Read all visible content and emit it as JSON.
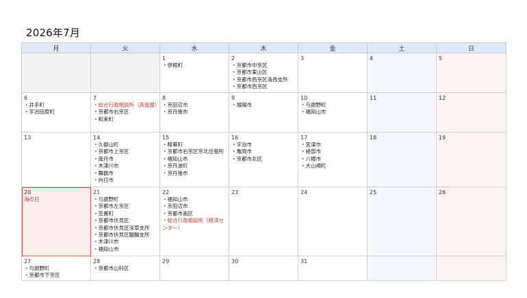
{
  "header": {
    "title": "2026年7月"
  },
  "weekdays": [
    "月",
    "火",
    "水",
    "木",
    "金",
    "土",
    "日"
  ],
  "weeks": [
    [
      {
        "day": "",
        "type": "empty",
        "holiday": "",
        "events": []
      },
      {
        "day": "",
        "type": "empty",
        "holiday": "",
        "events": []
      },
      {
        "day": "1",
        "type": "wk",
        "holiday": "",
        "events": [
          {
            "text": "・伊根町"
          }
        ]
      },
      {
        "day": "2",
        "type": "wk",
        "holiday": "",
        "events": [
          {
            "text": "・京都市中京区"
          },
          {
            "text": "・京都市東山区"
          },
          {
            "text": "・京都市西京区洛西支所"
          },
          {
            "text": "・京都市西京区"
          }
        ]
      },
      {
        "day": "3",
        "type": "wk",
        "holiday": "",
        "events": []
      },
      {
        "day": "4",
        "type": "sat",
        "holiday": "",
        "events": []
      },
      {
        "day": "5",
        "type": "sun",
        "holiday": "",
        "events": []
      }
    ],
    [
      {
        "day": "6",
        "type": "wk",
        "holiday": "",
        "events": [
          {
            "text": "・井手町"
          },
          {
            "text": "・宇治田原町"
          }
        ]
      },
      {
        "day": "7",
        "type": "wk",
        "holiday": "",
        "events": [
          {
            "text": "・総合行政相談所（高島屋）",
            "red": true,
            "wrap": true
          },
          {
            "text": "・京都市右京区"
          },
          {
            "text": "・和束町"
          }
        ]
      },
      {
        "day": "8",
        "type": "wk",
        "holiday": "",
        "events": [
          {
            "text": "・京田辺市"
          },
          {
            "text": "・京丹後市"
          }
        ]
      },
      {
        "day": "9",
        "type": "wk",
        "holiday": "",
        "events": [
          {
            "text": "・城陽市"
          }
        ]
      },
      {
        "day": "10",
        "type": "wk",
        "holiday": "",
        "events": [
          {
            "text": "・与謝野町"
          },
          {
            "text": "・福知山市"
          }
        ]
      },
      {
        "day": "11",
        "type": "sat",
        "holiday": "",
        "events": []
      },
      {
        "day": "12",
        "type": "sun",
        "holiday": "",
        "events": []
      }
    ],
    [
      {
        "day": "13",
        "type": "wk",
        "holiday": "",
        "events": []
      },
      {
        "day": "14",
        "type": "wk",
        "holiday": "",
        "events": [
          {
            "text": "・久御山町"
          },
          {
            "text": "・京都市上京区"
          },
          {
            "text": "・南丹市"
          },
          {
            "text": "・木津川市"
          },
          {
            "text": "・舞鶴市"
          },
          {
            "text": "・向日市"
          }
        ]
      },
      {
        "day": "15",
        "type": "wk",
        "holiday": "",
        "events": [
          {
            "text": "・精華町"
          },
          {
            "text": "・京都市右京区京北出張所",
            "wrap": true
          },
          {
            "text": "・福知山市"
          },
          {
            "text": "・京丹波町"
          },
          {
            "text": "・京丹後市"
          }
        ]
      },
      {
        "day": "16",
        "type": "wk",
        "holiday": "",
        "events": [
          {
            "text": "・宇治市"
          },
          {
            "text": "・亀岡市"
          },
          {
            "text": "・京都市北区"
          }
        ]
      },
      {
        "day": "17",
        "type": "wk",
        "holiday": "",
        "events": [
          {
            "text": "・宮津市"
          },
          {
            "text": "・綾部市"
          },
          {
            "text": "・八幡市"
          },
          {
            "text": "・大山崎町"
          }
        ]
      },
      {
        "day": "18",
        "type": "sat",
        "holiday": "",
        "events": []
      },
      {
        "day": "19",
        "type": "sun",
        "holiday": "",
        "events": []
      }
    ],
    [
      {
        "day": "20",
        "type": "hol",
        "holiday": "海の日",
        "events": []
      },
      {
        "day": "21",
        "type": "wk",
        "holiday": "",
        "events": [
          {
            "text": "・与謝野町"
          },
          {
            "text": "・京都市左京区"
          },
          {
            "text": "・笠置町"
          },
          {
            "text": "・京都市伏見区"
          },
          {
            "text": "・京都市伏見区深草支所"
          },
          {
            "text": "・京都市伏見区醍醐支所"
          },
          {
            "text": "・木津川市"
          },
          {
            "text": "・福知山市"
          }
        ]
      },
      {
        "day": "22",
        "type": "wk",
        "holiday": "",
        "events": [
          {
            "text": "・福知山市"
          },
          {
            "text": "・京田辺市"
          },
          {
            "text": "・京都市南区"
          },
          {
            "text": "・総合行政相談所（経済センター）",
            "red": true,
            "wrap": true
          }
        ]
      },
      {
        "day": "23",
        "type": "wk",
        "holiday": "",
        "events": []
      },
      {
        "day": "24",
        "type": "wk",
        "holiday": "",
        "events": []
      },
      {
        "day": "25",
        "type": "sat",
        "holiday": "",
        "events": []
      },
      {
        "day": "26",
        "type": "sun",
        "holiday": "",
        "events": []
      }
    ],
    [
      {
        "day": "27",
        "type": "wk",
        "holiday": "",
        "events": [
          {
            "text": "・与謝野町"
          },
          {
            "text": "・京都市下京区"
          }
        ]
      },
      {
        "day": "28",
        "type": "wk",
        "holiday": "",
        "events": [
          {
            "text": "・京都市山科区"
          }
        ]
      },
      {
        "day": "29",
        "type": "wk",
        "holiday": "",
        "events": []
      },
      {
        "day": "30",
        "type": "wk",
        "holiday": "",
        "events": []
      },
      {
        "day": "31",
        "type": "wk",
        "holiday": "",
        "events": []
      },
      {
        "day": "",
        "type": "sat",
        "holiday": "",
        "events": []
      },
      {
        "day": "",
        "type": "sun",
        "holiday": "",
        "events": []
      }
    ]
  ]
}
